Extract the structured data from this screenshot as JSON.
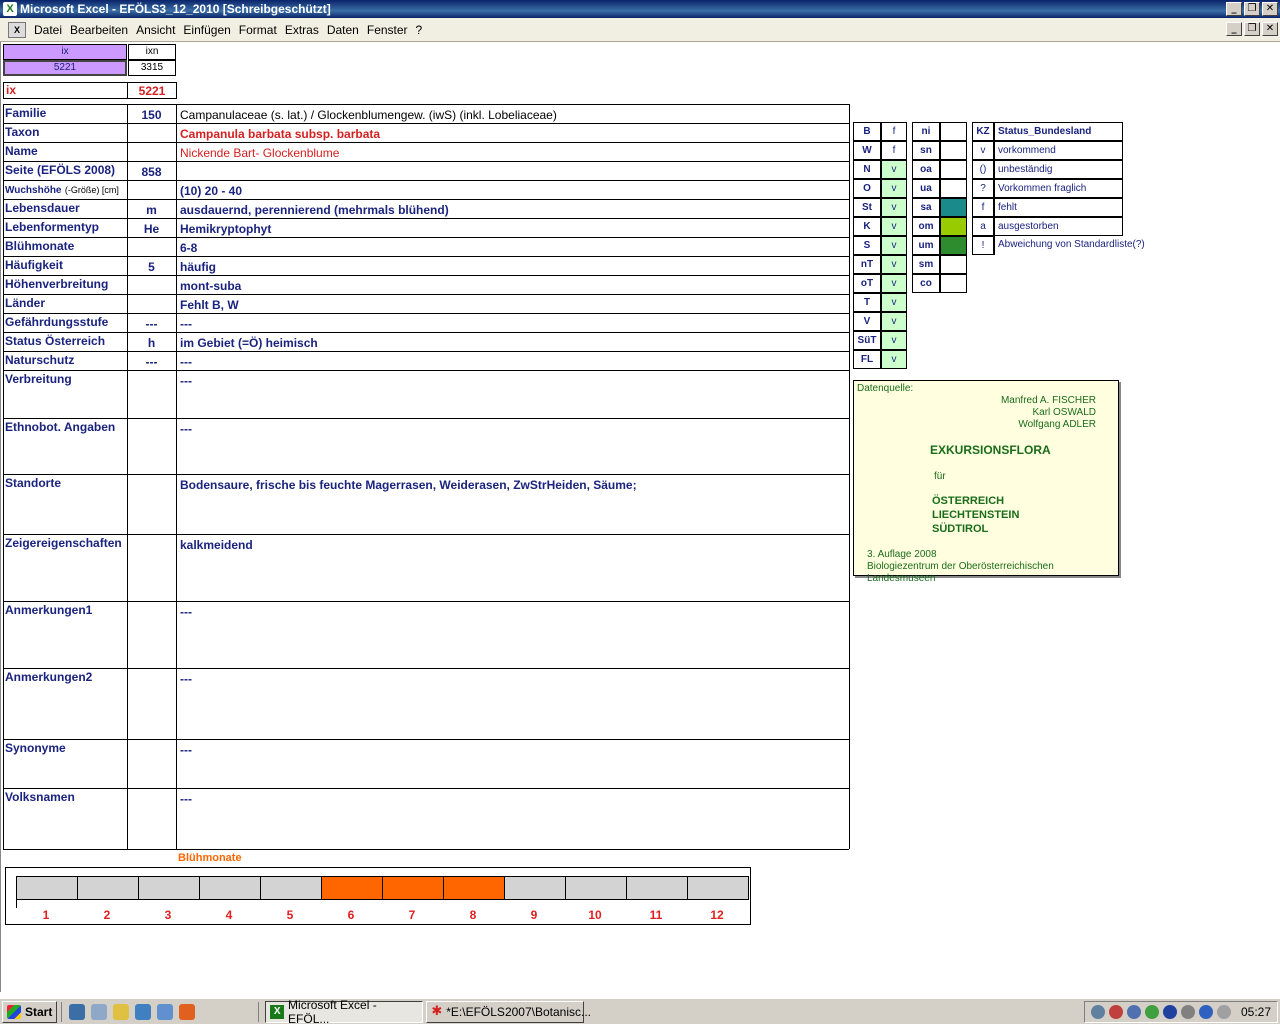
{
  "window": {
    "title": "Microsoft Excel - EFÖLS3_12_2010  [Schreibgeschützt]"
  },
  "menu": [
    "Datei",
    "Bearbeiten",
    "Ansicht",
    "Einfügen",
    "Format",
    "Extras",
    "Daten",
    "Fenster",
    "?"
  ],
  "index_box": {
    "ix_label": "ix",
    "ixn_label": "ixn",
    "ix_value": "5221",
    "ixn_value": "3315"
  },
  "ix_row": {
    "label": "ix",
    "value": "5221"
  },
  "rows": [
    {
      "label": "Familie",
      "code": "150",
      "value": "Campanulaceae (s. lat.)  /  Glockenblumengew. (iwS) (inkl. Lobeliaceae)"
    },
    {
      "label": "Taxon",
      "code": "",
      "value": "Campanula barbata subsp. barbata"
    },
    {
      "label": "Name",
      "code": "",
      "value": "Nickende Bart- Glockenblume"
    },
    {
      "label": "Seite (EFÖLS 2008)",
      "code": "858",
      "value": ""
    },
    {
      "label": "Wuchshöhe",
      "label_suffix": "(-Größe) [cm]",
      "code": "",
      "value": "(10) 20 - 40"
    },
    {
      "label": "Lebensdauer",
      "code": "m",
      "value": "ausdauernd, perennierend (mehrmals blühend)"
    },
    {
      "label": "Lebenformentyp",
      "code": "He",
      "value": "Hemikryptophyt"
    },
    {
      "label": "Blühmonate",
      "code": "",
      "value": "6-8"
    },
    {
      "label": "Häufigkeit",
      "code": "5",
      "value": "häufig"
    },
    {
      "label": "Höhenverbreitung",
      "code": "",
      "value": "mont-suba"
    },
    {
      "label": "Länder",
      "code": "",
      "value": "Fehlt B, W"
    },
    {
      "label": "Gefährdungsstufe",
      "code": "---",
      "value": "---"
    },
    {
      "label": "Status Österreich",
      "code": "h",
      "value": "im Gebiet (=Ö) heimisch"
    },
    {
      "label": "Naturschutz",
      "code": "---",
      "value": "---"
    },
    {
      "label": "Verbreitung",
      "code": "",
      "value": "---"
    },
    {
      "label": "Ethnobot. Angaben",
      "code": "",
      "value": "---"
    },
    {
      "label": "Standorte",
      "code": "",
      "value": "Bodensaure, frische bis feuchte Magerrasen, Weiderasen, ZwStrHeiden, Säume;"
    },
    {
      "label": "Zeigereigenschaften",
      "code": "",
      "value": "kalkmeidend"
    },
    {
      "label": "Anmerkungen1",
      "code": "",
      "value": "---"
    },
    {
      "label": "Anmerkungen2",
      "code": "",
      "value": "---"
    },
    {
      "label": "Synonyme",
      "code": "",
      "value": "---"
    },
    {
      "label": "Volksnamen",
      "code": "",
      "value": "---"
    }
  ],
  "states": [
    {
      "code": "B",
      "status": "f"
    },
    {
      "code": "W",
      "status": "f"
    },
    {
      "code": "N",
      "status": "v"
    },
    {
      "code": "O",
      "status": "v"
    },
    {
      "code": "St",
      "status": "v"
    },
    {
      "code": "K",
      "status": "v"
    },
    {
      "code": "S",
      "status": "v"
    },
    {
      "code": "nT",
      "status": "v"
    },
    {
      "code": "oT",
      "status": "v"
    },
    {
      "code": "T",
      "status": "v"
    },
    {
      "code": "V",
      "status": "v"
    },
    {
      "code": "SüT",
      "status": "v"
    },
    {
      "code": "FL",
      "status": "v"
    }
  ],
  "altitude": [
    {
      "code": "ni",
      "color": ""
    },
    {
      "code": "sn",
      "color": ""
    },
    {
      "code": "oa",
      "color": ""
    },
    {
      "code": "ua",
      "color": ""
    },
    {
      "code": "sa",
      "color": "#1a8a8a"
    },
    {
      "code": "om",
      "color": "#99cc00"
    },
    {
      "code": "um",
      "color": "#2e8b2e"
    },
    {
      "code": "sm",
      "color": ""
    },
    {
      "code": "co",
      "color": ""
    }
  ],
  "legend": {
    "header_code": "KZ",
    "header_label": "Status_Bundesland",
    "items": [
      {
        "code": "v",
        "label": "vorkommend"
      },
      {
        "code": "()",
        "label": "unbeständig"
      },
      {
        "code": "?",
        "label": "Vorkommen fraglich"
      },
      {
        "code": "f",
        "label": "fehlt"
      },
      {
        "code": "a",
        "label": "ausgestorben"
      },
      {
        "code": "!",
        "label": "Abweichung von Standardliste(?)"
      }
    ]
  },
  "source": {
    "label": "Datenquelle:",
    "authors": [
      "Manfred A. FISCHER",
      "Karl OSWALD",
      "Wolfgang ADLER"
    ],
    "title": "EXKURSIONSFLORA",
    "fuer": "für",
    "regions": [
      "ÖSTERREICH",
      "LIECHTENSTEIN",
      "SÜDTIROL"
    ],
    "edition": "3. Auflage 2008",
    "publisher": "Biologiezentrum der Oberösterreichischen Landesmuseen"
  },
  "bloom": {
    "title": "Blühmonate",
    "months": [
      "1",
      "2",
      "3",
      "4",
      "5",
      "6",
      "7",
      "8",
      "9",
      "10",
      "11",
      "12"
    ],
    "active": [
      0,
      0,
      0,
      0,
      0,
      1,
      1,
      1,
      0,
      0,
      0,
      0
    ],
    "active_color": "#ff6600",
    "inactive_color": "#d3d3d3"
  },
  "taskbar": {
    "start": "Start",
    "tasks": [
      "Microsoft Excel - EFÖL...",
      "*E:\\EFÖLS2007\\Botanisc..."
    ],
    "clock": "05:27"
  }
}
